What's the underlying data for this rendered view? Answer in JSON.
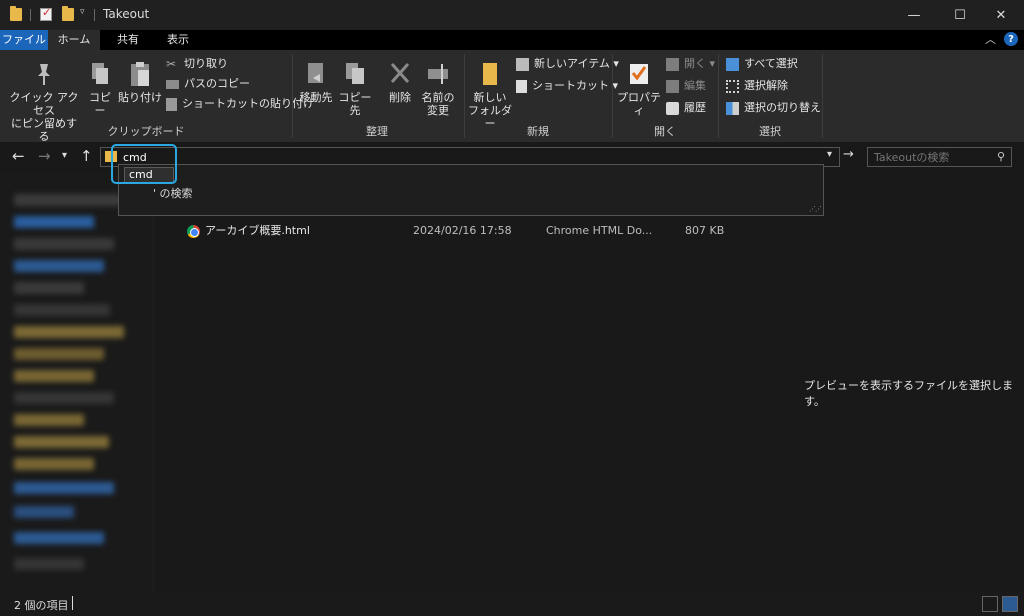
{
  "window": {
    "title": "Takeout",
    "minimize_glyph": "—",
    "maximize_glyph": "☐",
    "close_glyph": "✕"
  },
  "ribbon_tabs": {
    "file": "ファイル",
    "home": "ホーム",
    "share": "共有",
    "view": "表示",
    "help_glyph": "?"
  },
  "ribbon": {
    "clipboard": {
      "label": "クリップボード",
      "pin_line1": "クイック アクセス",
      "pin_line2": "にピン留めする",
      "copy": "コピー",
      "paste": "貼り付け",
      "cut": "切り取り",
      "copy_path": "パスのコピー",
      "paste_shortcut": "ショートカットの貼り付け"
    },
    "organize": {
      "label": "整理",
      "move_to": "移動先",
      "copy_to": "コピー先",
      "delete": "削除",
      "rename_line1": "名前の",
      "rename_line2": "変更"
    },
    "new": {
      "label": "新規",
      "new_folder_line1": "新しい",
      "new_folder_line2": "フォルダー",
      "new_item": "新しいアイテム ▾",
      "shortcut": "ショートカット ▾"
    },
    "open": {
      "label": "開く",
      "properties": "プロパティ",
      "open": "開く ▾",
      "edit": "編集",
      "history": "履歴"
    },
    "select": {
      "label": "選択",
      "select_all": "すべて選択",
      "select_none": "選択解除",
      "invert": "選択の切り替え"
    }
  },
  "address": {
    "value": "cmd",
    "search_placeholder": "Takeoutの検索",
    "autocomplete_item": "cmd",
    "search_suggestion": "' の検索"
  },
  "files": [
    {
      "name": "アーカイブ概要.html",
      "modified": "2024/02/16 17:58",
      "type": "Chrome HTML Do...",
      "size": "807 KB"
    }
  ],
  "preview": {
    "message": "プレビューを表示するファイルを選択します。"
  },
  "status": {
    "item_count": "2 個の項目"
  },
  "colors": {
    "accent": "#1b66bb",
    "highlight": "#29a9e0",
    "folder": "#e8b94a"
  }
}
